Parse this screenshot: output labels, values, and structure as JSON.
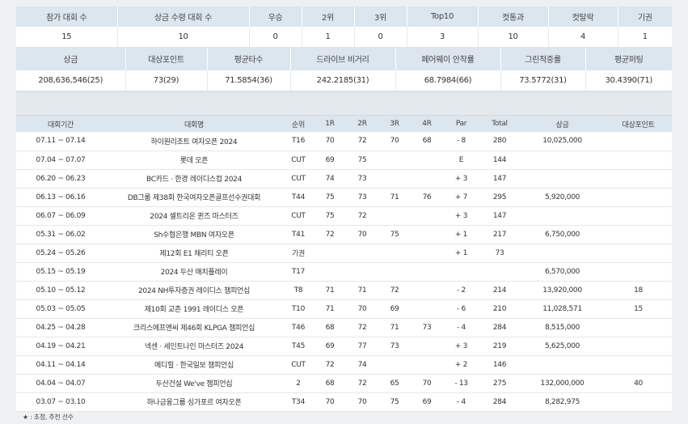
{
  "summary1": {
    "headers": [
      "참가 대회 수",
      "상금 수령 대회 수",
      "우승",
      "2위",
      "3위",
      "Top10",
      "컷통과",
      "컷탈락",
      "기권"
    ],
    "values": [
      "15",
      "10",
      "0",
      "1",
      "0",
      "3",
      "10",
      "4",
      "1"
    ]
  },
  "summary2": {
    "headers": [
      "상금",
      "대상포인트",
      "평균타수",
      "드라이브 비거리",
      "페어웨이 안착률",
      "그린적중률",
      "평균퍼팅"
    ],
    "values": [
      "208,636,546(25)",
      "73(29)",
      "71.5854(36)",
      "242.2185(31)",
      "68.7984(66)",
      "73.5772(31)",
      "30.4390(71)"
    ]
  },
  "results": {
    "headers": [
      "대회기간",
      "대회명",
      "순위",
      "1R",
      "2R",
      "3R",
      "4R",
      "Par",
      "Total",
      "상금",
      "대상포인트"
    ],
    "rows": [
      [
        "07.11 ~ 07.14",
        "하이원리조트 여자오픈 2024",
        "T16",
        "70",
        "72",
        "70",
        "68",
        "- 8",
        "280",
        "10,025,000",
        ""
      ],
      [
        "07.04 ~ 07.07",
        "롯데 오픈",
        "CUT",
        "69",
        "75",
        "",
        "",
        "E",
        "144",
        "",
        ""
      ],
      [
        "06.20 ~ 06.23",
        "BC카드 · 한경 레이디스컵 2024",
        "CUT",
        "74",
        "73",
        "",
        "",
        "+ 3",
        "147",
        "",
        ""
      ],
      [
        "06.13 ~ 06.16",
        "DB그룹 제38회 한국여자오픈골프선수권대회",
        "T44",
        "75",
        "73",
        "71",
        "76",
        "+ 7",
        "295",
        "5,920,000",
        ""
      ],
      [
        "06.07 ~ 06.09",
        "2024 셀트리온 퀸즈 마스터즈",
        "CUT",
        "75",
        "72",
        "",
        "",
        "+ 3",
        "147",
        "",
        ""
      ],
      [
        "05.31 ~ 06.02",
        "Sh수협은행 MBN 여자오픈",
        "T41",
        "72",
        "70",
        "75",
        "",
        "+ 1",
        "217",
        "6,750,000",
        ""
      ],
      [
        "05.24 ~ 05.26",
        "제12회 E1 채리티 오픈",
        "기권",
        "",
        "",
        "",
        "",
        "+ 1",
        "73",
        "",
        ""
      ],
      [
        "05.15 ~ 05.19",
        "2024 두산 매치플레이",
        "T17",
        "",
        "",
        "",
        "",
        "",
        "",
        "6,570,000",
        ""
      ],
      [
        "05.10 ~ 05.12",
        "2024 NH투자증권 레이디스 챔피언십",
        "T8",
        "71",
        "71",
        "72",
        "",
        "- 2",
        "214",
        "13,920,000",
        "18"
      ],
      [
        "05.03 ~ 05.05",
        "제10회 교촌 1991 레이디스 오픈",
        "T10",
        "71",
        "70",
        "69",
        "",
        "- 6",
        "210",
        "11,028,571",
        "15"
      ],
      [
        "04.25 ~ 04.28",
        "크리스에프앤씨 제46회 KLPGA 챔피언십",
        "T46",
        "68",
        "72",
        "71",
        "73",
        "- 4",
        "284",
        "8,515,000",
        ""
      ],
      [
        "04.19 ~ 04.21",
        "넥센 · 세인트나인 마스터즈 2024",
        "T45",
        "69",
        "77",
        "73",
        "",
        "+ 3",
        "219",
        "5,625,000",
        ""
      ],
      [
        "04.11 ~ 04.14",
        "메디힐 · 한국일보 챔피언십",
        "CUT",
        "72",
        "74",
        "",
        "",
        "+ 2",
        "146",
        "",
        ""
      ],
      [
        "04.04 ~ 04.07",
        "두산건설 We've 챔피언십",
        "2",
        "68",
        "72",
        "65",
        "70",
        "- 13",
        "275",
        "132,000,000",
        "40"
      ],
      [
        "03.07 ~ 03.10",
        "하나금융그룹 싱가포르 여자오픈",
        "T34",
        "70",
        "70",
        "75",
        "69",
        "- 4",
        "284",
        "8,282,975",
        ""
      ]
    ]
  },
  "footnote": "★ : 초청, 추천 선수"
}
